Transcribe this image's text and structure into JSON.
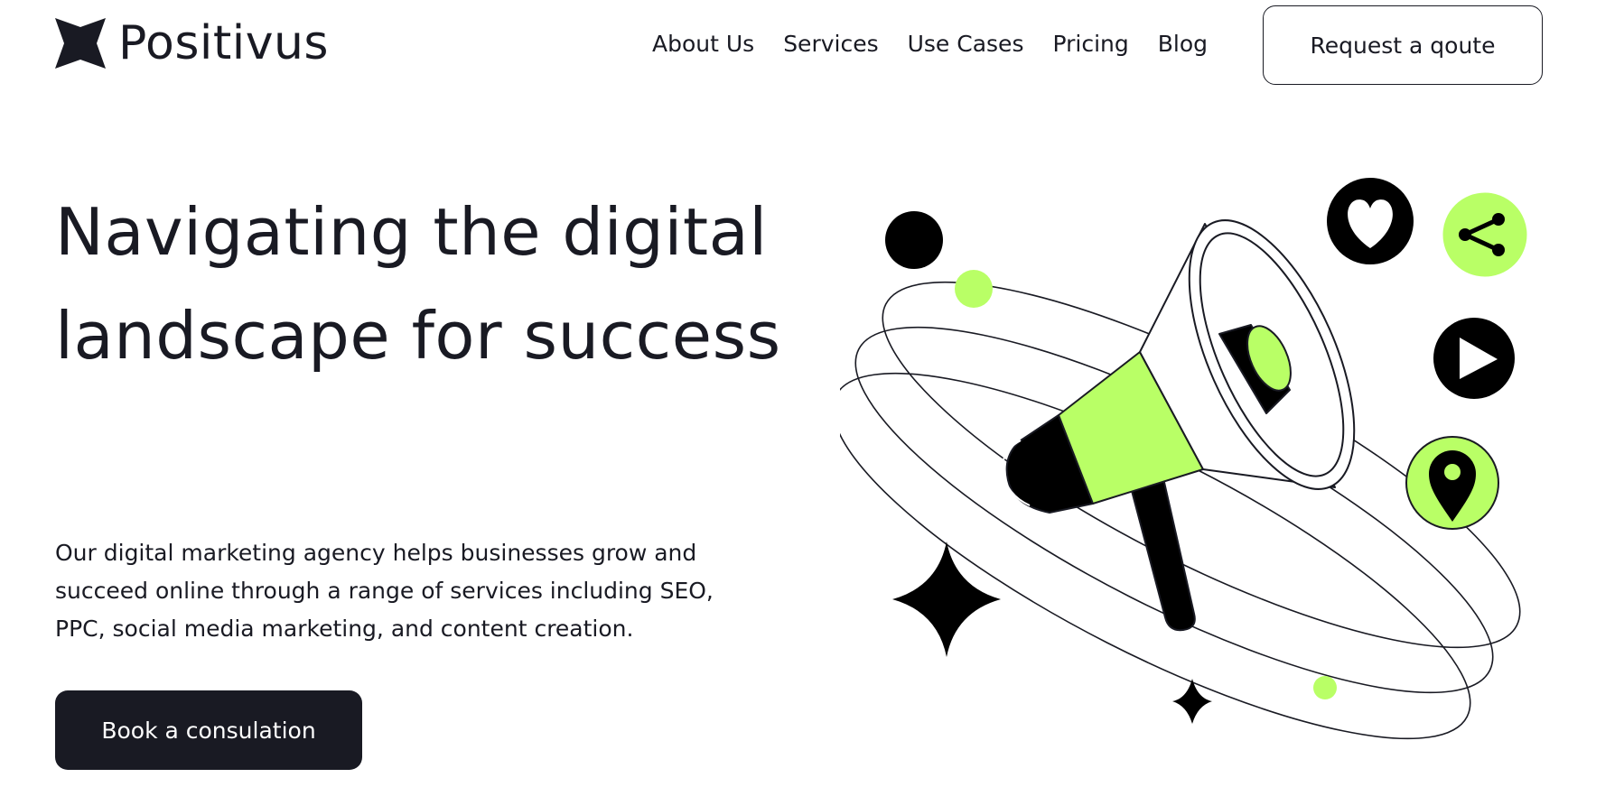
{
  "brand": {
    "name": "Positivus",
    "accent": "#B9FF66",
    "dark": "#191A23"
  },
  "nav": {
    "items": [
      {
        "label": "About Us"
      },
      {
        "label": "Services"
      },
      {
        "label": "Use Cases"
      },
      {
        "label": "Pricing"
      },
      {
        "label": "Blog"
      }
    ],
    "cta_label": "Request a qoute"
  },
  "hero": {
    "title": "Navigating the digital landscape for success",
    "description": "Our digital marketing agency helps businesses grow and succeed online through a range of services including SEO, PPC, social media marketing, and content creation.",
    "cta_label": "Book a consulation"
  },
  "illustration": {
    "icons": [
      "megaphone-icon",
      "heart-icon",
      "share-icon",
      "play-icon",
      "location-pin-icon",
      "sparkle-star-icon"
    ]
  }
}
